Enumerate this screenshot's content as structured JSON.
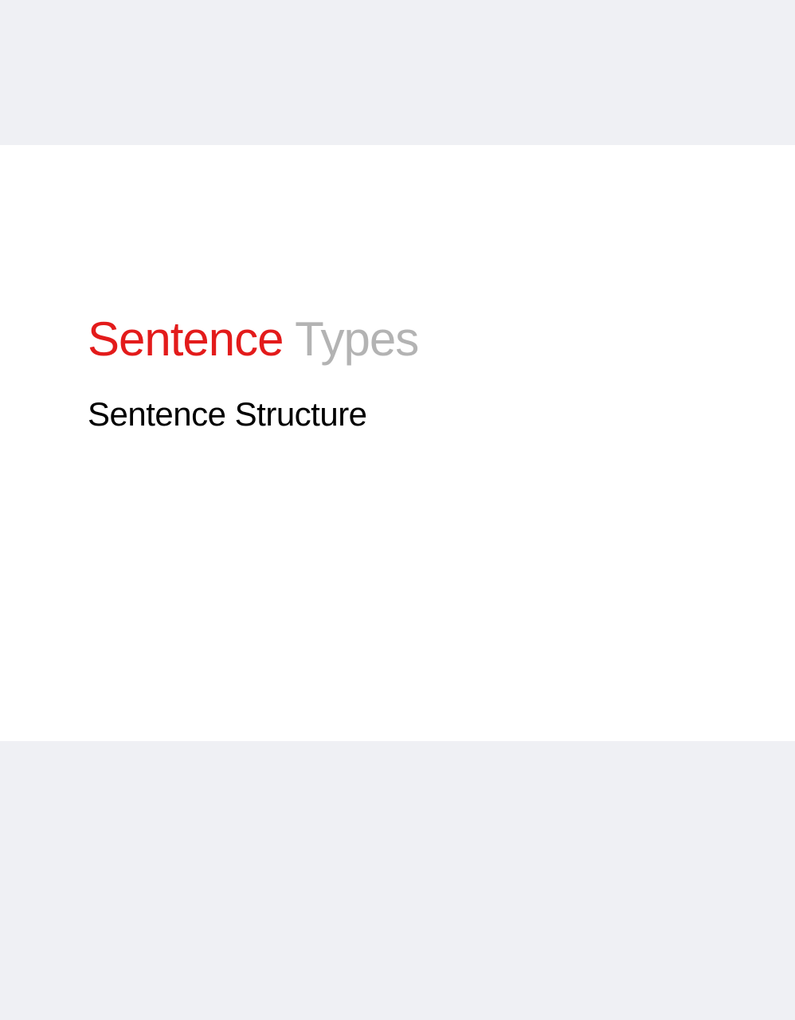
{
  "slide": {
    "title_primary": "Sentence",
    "title_secondary": "Types",
    "subtitle": "Sentence Structure"
  },
  "colors": {
    "background": "#eff0f4",
    "page": "#ffffff",
    "accent": "#e31b1b",
    "muted": "#b3b3b3",
    "text": "#000000"
  }
}
